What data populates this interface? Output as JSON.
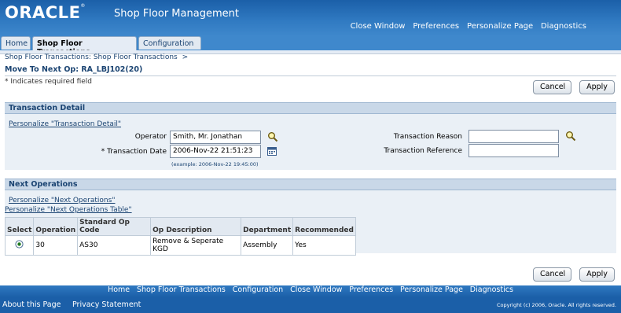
{
  "brand": {
    "logo_text": "ORACLE",
    "app_title": "Shop Floor Management"
  },
  "global_links": [
    "Close Window",
    "Preferences",
    "Personalize Page",
    "Diagnostics"
  ],
  "tabs": [
    {
      "label": "Home",
      "active": false
    },
    {
      "label": "Shop Floor Transactions",
      "active": true
    },
    {
      "label": "Configuration",
      "active": false
    }
  ],
  "breadcrumb": {
    "link": "Shop Floor Transactions: Shop Floor Transactions",
    "separator": ">"
  },
  "page": {
    "title": "Move To Next Op: RA_LBJ102(20)",
    "required_note": "* Indicates required field"
  },
  "buttons": {
    "cancel": "Cancel",
    "apply": "Apply"
  },
  "transaction_detail": {
    "header": "Transaction Detail",
    "personalize_link": "Personalize \"Transaction Detail\"",
    "operator": {
      "label": "Operator",
      "value": "Smith, Mr. Jonathan"
    },
    "transaction_date": {
      "required_mark": "*",
      "label": "Transaction Date",
      "value": "2006-Nov-22 21:51:23",
      "hint": "(example: 2006-Nov-22 19:45:00)"
    },
    "transaction_reason": {
      "label": "Transaction Reason",
      "value": ""
    },
    "transaction_reference": {
      "label": "Transaction Reference",
      "value": ""
    }
  },
  "next_operations": {
    "header": "Next Operations",
    "personalize_link": "Personalize \"Next Operations\"",
    "personalize_table_link": "Personalize \"Next Operations Table\"",
    "columns": [
      "Select",
      "Operation",
      "Standard Op Code",
      "Op Description",
      "Department",
      "Recommended"
    ],
    "rows": [
      {
        "selected": true,
        "operation": "30",
        "std_op_code": "AS30",
        "op_description": "Remove & Seperate KGD",
        "department": "Assembly",
        "recommended": "Yes"
      }
    ]
  },
  "footer": {
    "links": [
      "Home",
      "Shop Floor Transactions",
      "Configuration",
      "Close Window",
      "Preferences",
      "Personalize Page",
      "Diagnostics"
    ],
    "about": "About this Page",
    "privacy": "Privacy Statement",
    "copyright": "Copyright (c) 2006, Oracle. All rights reserved."
  },
  "icons": {
    "search": "magnifier-icon",
    "calendar": "calendar-icon",
    "radio": "radio-selected-icon"
  },
  "colors": {
    "header_blue": "#1b5fa8",
    "section_header": "#c9d8e8",
    "link_blue": "#1b4472"
  }
}
